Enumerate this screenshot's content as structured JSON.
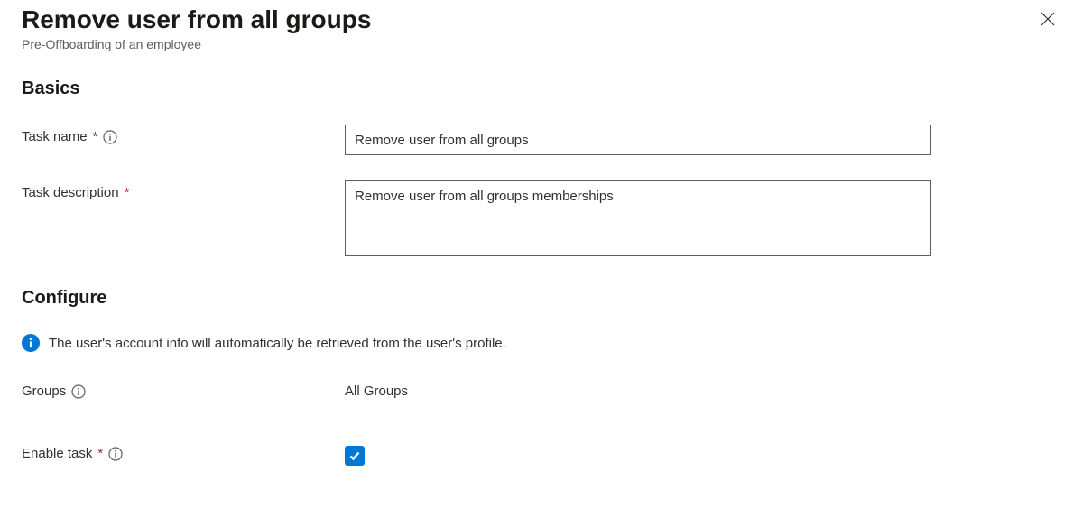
{
  "header": {
    "title": "Remove user from all groups",
    "subtitle": "Pre-Offboarding of an employee"
  },
  "sections": {
    "basics": "Basics",
    "configure": "Configure"
  },
  "fields": {
    "task_name": {
      "label": "Task name",
      "value": "Remove user from all groups"
    },
    "task_description": {
      "label": "Task description",
      "value": "Remove user from all groups memberships"
    },
    "groups": {
      "label": "Groups",
      "value": "All Groups"
    },
    "enable_task": {
      "label": "Enable task",
      "checked": true
    }
  },
  "info_banner": {
    "text": "The user's account info will automatically be retrieved from the user's profile."
  }
}
